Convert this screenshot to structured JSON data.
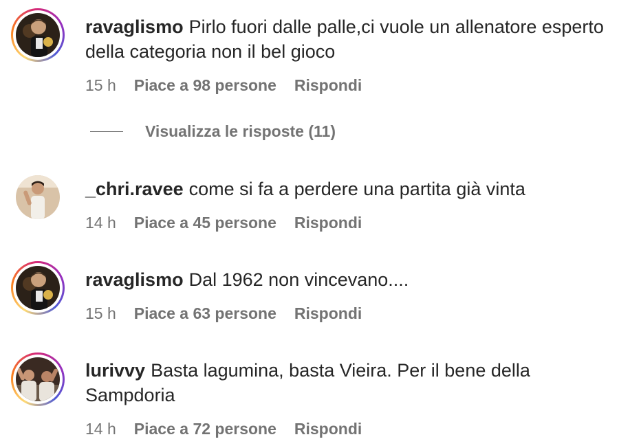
{
  "comments": [
    {
      "username": "ravaglismo",
      "text": "Pirlo fuori dalle palle,ci vuole un allenatore esperto della categoria non il bel gioco",
      "time": "15 h",
      "likes": "Piace a 98 persone",
      "reply": "Rispondi",
      "story_ring": true
    },
    {
      "username": "_chri.ravee",
      "text": "come si fa a perdere una partita già vinta",
      "time": "14 h",
      "likes": "Piace a 45 persone",
      "reply": "Rispondi",
      "story_ring": false
    },
    {
      "username": "ravaglismo",
      "text": "Dal 1962 non vincevano....",
      "time": "15 h",
      "likes": "Piace a 63 persone",
      "reply": "Rispondi",
      "story_ring": true
    },
    {
      "username": "lurivvy",
      "text": "Basta lagumina, basta Vieira. Per il bene della Sampdoria",
      "time": "14 h",
      "likes": "Piace a 72 persone",
      "reply": "Rispondi",
      "story_ring": true
    }
  ],
  "view_replies": {
    "label": "Visualizza le risposte (11)"
  },
  "colors": {
    "text": "#262626",
    "secondary": "#737373",
    "ring_gradient": [
      "#feda75",
      "#fa7e1e",
      "#d62976",
      "#962fbf",
      "#4f5bd5"
    ]
  }
}
